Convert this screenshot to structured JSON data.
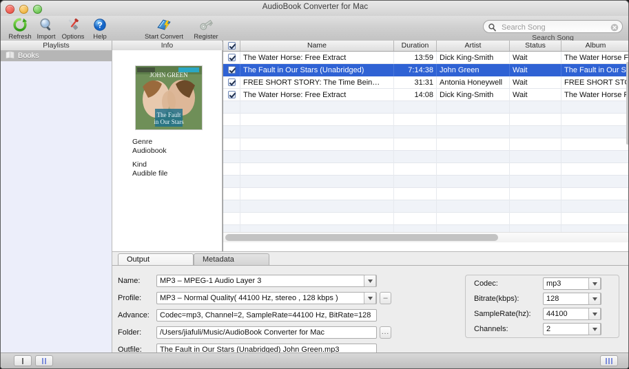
{
  "window": {
    "title": "AudioBook Converter for Mac"
  },
  "toolbar": {
    "items": [
      {
        "label": "Refresh",
        "icon": "refresh-icon"
      },
      {
        "label": "Import",
        "icon": "magnifier-icon"
      },
      {
        "label": "Options",
        "icon": "tools-icon"
      },
      {
        "label": "Help",
        "icon": "help-icon"
      },
      {
        "label": "Start Convert",
        "icon": "convert-book-icon"
      },
      {
        "label": "Register",
        "icon": "key-icon"
      }
    ],
    "search": {
      "placeholder": "Search Song",
      "value": "",
      "caption": "Search Song"
    }
  },
  "panels": {
    "playlists_header": "Playlists",
    "info_header": "Info"
  },
  "playlists": {
    "items": [
      {
        "label": "Books",
        "selected": true
      }
    ]
  },
  "info": {
    "fields": [
      {
        "label": "Genre",
        "value": "Audiobook"
      },
      {
        "label": "Kind",
        "value": "Audible file"
      }
    ]
  },
  "table": {
    "columns": [
      "Name",
      "Duration",
      "Artist",
      "Status",
      "Album"
    ],
    "rows": [
      {
        "checked": true,
        "name": "The Water Horse: Free Extract",
        "duration": "13:59",
        "artist": "Dick King-Smith",
        "status": "Wait",
        "album": "The Water Horse Free Ext.",
        "selected": false
      },
      {
        "checked": true,
        "name": "The Fault in Our Stars (Unabridged)",
        "duration": "7:14:38",
        "artist": "John Green",
        "status": "Wait",
        "album": "The Fault in Our Stars (Un",
        "selected": true
      },
      {
        "checked": true,
        "name": "FREE SHORT STORY: The Time Bein…",
        "duration": "31:31",
        "artist": "Antonia Honeywell",
        "status": "Wait",
        "album": "FREE SHORT STORY The T",
        "selected": false
      },
      {
        "checked": true,
        "name": "The Water Horse: Free Extract",
        "duration": "14:08",
        "artist": "Dick King-Smith",
        "status": "Wait",
        "album": "The Water Horse Free Ext.",
        "selected": false
      }
    ]
  },
  "editor": {
    "tabs": [
      {
        "label": "Output",
        "active": true
      },
      {
        "label": "Metadata",
        "active": false
      }
    ],
    "fields": {
      "name_label": "Name:",
      "name_value": "MP3 – MPEG-1 Audio Layer 3",
      "profile_label": "Profile:",
      "profile_value": "MP3 – Normal Quality( 44100 Hz, stereo , 128 kbps )",
      "profile_remove_label": "–",
      "advance_label": "Advance:",
      "advance_value": "Codec=mp3, Channel=2, SampleRate=44100 Hz, BitRate=128",
      "folder_label": "Folder:",
      "folder_value": "/Users/jiafuli/Music/AudioBook Converter for Mac",
      "folder_browse_label": "...",
      "outfile_label": "Outfile:",
      "outfile_value": "The Fault in Our Stars (Unabridged) John Green.mp3"
    },
    "codec": {
      "rows": [
        {
          "label": "Codec:",
          "value": "mp3"
        },
        {
          "label": "Bitrate(kbps):",
          "value": "128"
        },
        {
          "label": "SampleRate(hz):",
          "value": "44100"
        },
        {
          "label": "Channels:",
          "value": "2"
        }
      ]
    }
  },
  "statusbar": {
    "buttons": [
      {
        "name": "stop-button",
        "bars": 1
      },
      {
        "name": "pause-button",
        "bars": 2
      },
      {
        "name": "progress-button",
        "bars": 3
      }
    ]
  },
  "colors": {
    "selection_blue": "#2f62d4",
    "playlist_bg": "#eceefa",
    "row_alt": "#f0f3f8",
    "chrome": "#ededed"
  }
}
